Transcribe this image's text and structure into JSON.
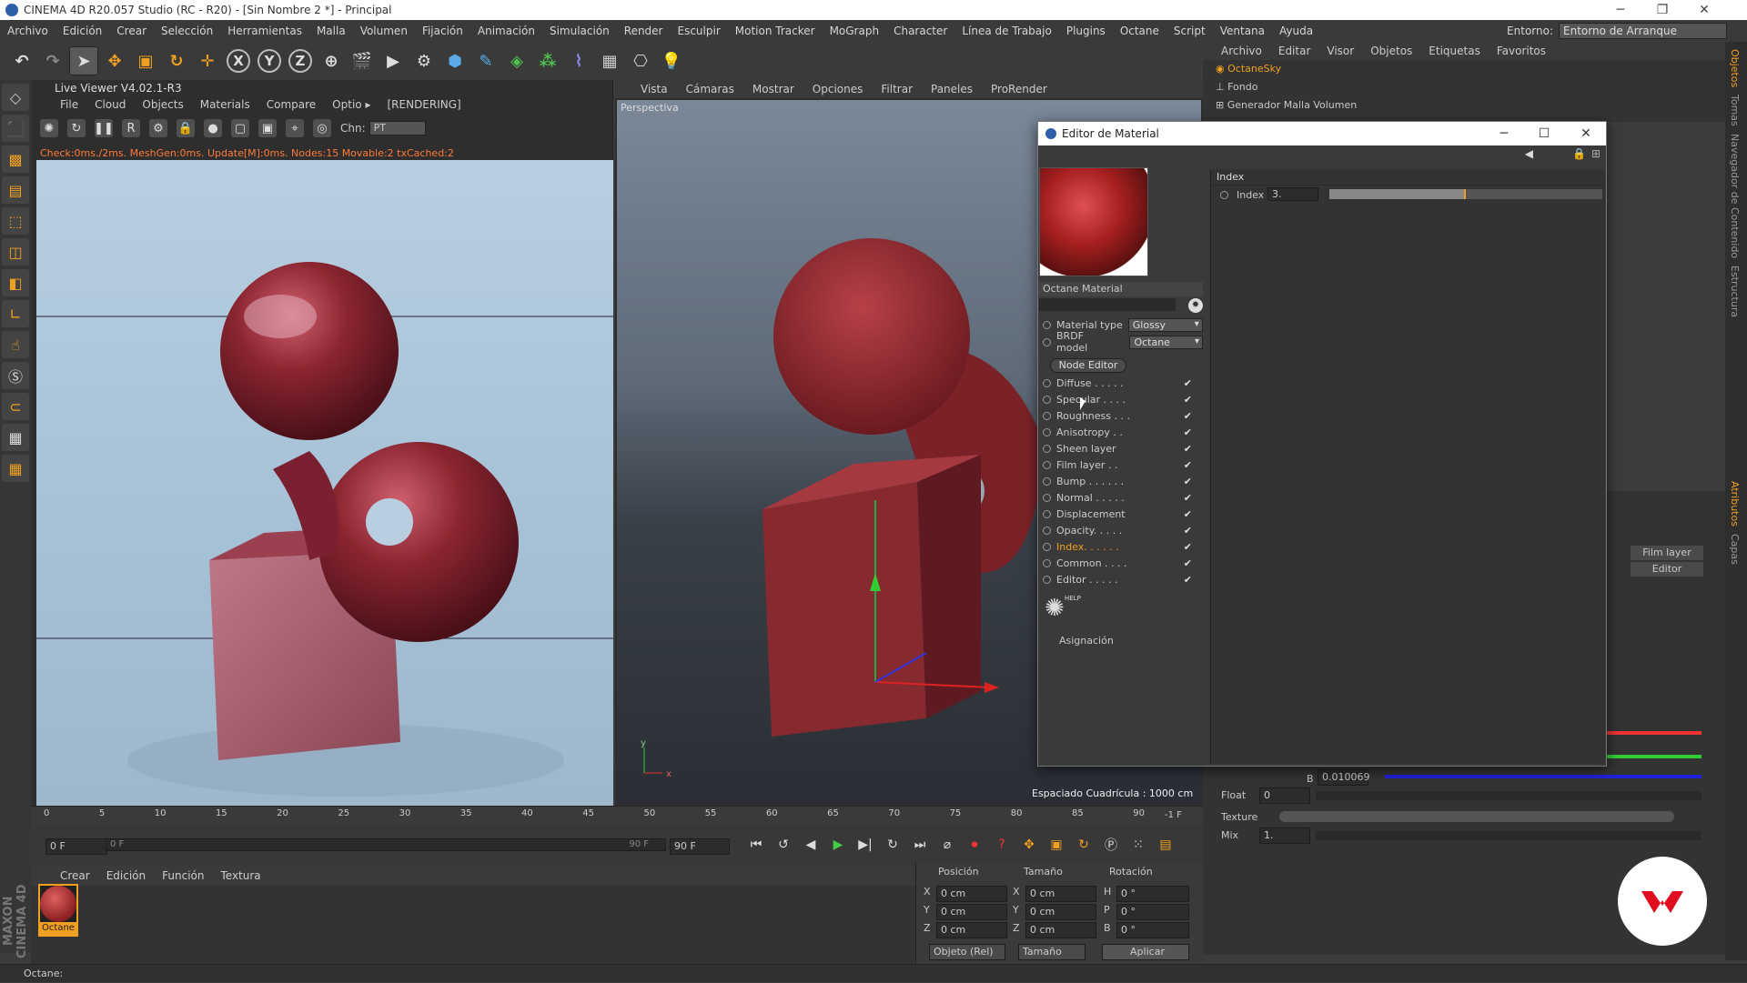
{
  "window": {
    "title": "CINEMA 4D R20.057 Studio (RC - R20) - [Sin Nombre 2 *] - Principal"
  },
  "menubar": {
    "items": [
      "Archivo",
      "Edición",
      "Crear",
      "Selección",
      "Herramientas",
      "Malla",
      "Volumen",
      "Fijación",
      "Animación",
      "Simulación",
      "Render",
      "Esculpir",
      "Motion Tracker",
      "MoGraph",
      "Character",
      "Línea de Trabajo",
      "Plugins",
      "Octane",
      "Script",
      "Ventana",
      "Ayuda"
    ],
    "entorno_label": "Entorno:",
    "entorno_value": "Entorno de Arranque"
  },
  "toolbar": {
    "icons": [
      "undo-icon",
      "redo-icon",
      "select-icon",
      "move-icon",
      "scale-icon",
      "rotate-icon",
      "live-select-icon",
      "x-axis",
      "y-axis",
      "z-axis",
      "world-coord-icon",
      "render-view-icon",
      "render-picture-icon",
      "render-settings-icon",
      "cube-icon",
      "pen-icon",
      "subdivision-icon",
      "array-icon",
      "deformer-icon",
      "floor-icon",
      "camera-icon",
      "light-icon"
    ],
    "axis_x": "X",
    "axis_y": "Y",
    "axis_z": "Z"
  },
  "live_viewer": {
    "title": "Live Viewer V4.02.1-R3",
    "menu": [
      "File",
      "Cloud",
      "Objects",
      "Materials",
      "Compare",
      "Optio"
    ],
    "menu_more": "▸",
    "rendering": "[RENDERING]",
    "channel_label": "Chn:",
    "channel_value": "PT",
    "status": "Check:0ms./2ms. MeshGen:0ms. Update[M]:0ms. Nodes:15 Movable:2 txCached:2"
  },
  "viewport": {
    "menu": [
      "Vista",
      "Cámaras",
      "Mostrar",
      "Opciones",
      "Filtrar",
      "Paneles",
      "ProRender"
    ],
    "label": "Perspectiva",
    "grid_info": "Espaciado Cuadrícula : 1000 cm"
  },
  "timeline": {
    "ticks": [
      "0",
      "5",
      "10",
      "15",
      "20",
      "25",
      "30",
      "35",
      "40",
      "45",
      "50",
      "55",
      "60",
      "65",
      "70",
      "75",
      "80",
      "85",
      "90"
    ],
    "current_frame": "-1 F",
    "start": "0 F",
    "range_start": "0 F",
    "range_end": "90 F",
    "end": "90 F"
  },
  "material_manager": {
    "menu": [
      "Crear",
      "Edición",
      "Función",
      "Textura"
    ],
    "material_name": "Octane"
  },
  "coordinates": {
    "headers": [
      "Posición",
      "Tamaño",
      "Rotación"
    ],
    "rows": [
      {
        "axis": "X",
        "pos": "0 cm",
        "size_axis": "X",
        "size": "0 cm",
        "rot_axis": "H",
        "rot": "0 °"
      },
      {
        "axis": "Y",
        "pos": "0 cm",
        "size_axis": "Y",
        "size": "0 cm",
        "rot_axis": "P",
        "rot": "0 °"
      },
      {
        "axis": "Z",
        "pos": "0 cm",
        "size_axis": "Z",
        "size": "0 cm",
        "rot_axis": "B",
        "rot": "0 °"
      }
    ],
    "mode": "Objeto (Rel)",
    "size_mode": "Tamaño",
    "apply": "Aplicar"
  },
  "object_manager": {
    "menu": [
      "Archivo",
      "Editar",
      "Visor",
      "Objetos",
      "Etiquetas",
      "Favoritos"
    ],
    "objects": [
      "OctaneSky",
      "Fondo",
      "Generador Malla Volumen"
    ]
  },
  "attributes": {
    "tabs": [
      "Film layer",
      "Editor"
    ],
    "b_value": "0.010069",
    "b_label": "B",
    "float_label": "Float",
    "float_value": "0",
    "texture_label": "Texture",
    "mix_label": "Mix",
    "mix_value": "1."
  },
  "right_tabs": [
    "Objetos",
    "Tomas",
    "Navegador de Contenido",
    "Estructura",
    "Atributos",
    "Capas"
  ],
  "material_editor": {
    "title": "Editor de Material",
    "material_name": "Octane Material",
    "material_type_label": "Material type",
    "material_type": "Glossy",
    "brdf_label": "BRDF model",
    "brdf": "Octane",
    "node_editor": "Node Editor",
    "channels": [
      {
        "label": "Diffuse . . . . .",
        "checked": true
      },
      {
        "label": "Specular . . . .",
        "checked": true
      },
      {
        "label": "Roughness . . .",
        "checked": true
      },
      {
        "label": "Anisotropy . .",
        "checked": true
      },
      {
        "label": "Sheen layer",
        "checked": true
      },
      {
        "label": "Film layer . .",
        "checked": true
      },
      {
        "label": "Bump . . . . . .",
        "checked": true
      },
      {
        "label": "Normal . . . . .",
        "checked": true
      },
      {
        "label": "Displacement",
        "checked": true
      },
      {
        "label": "Opacity. . . . .",
        "checked": true
      },
      {
        "label": "Index. . . . . .",
        "checked": true,
        "active": true
      },
      {
        "label": "Common . . . .",
        "checked": true
      },
      {
        "label": "Editor . . . . .",
        "checked": true
      }
    ],
    "help_label": "HELP",
    "assign": "Asignación",
    "section": "Index",
    "index_label": "Index",
    "index_value": "3.",
    "index_fraction": 0.5
  },
  "status": {
    "text": "Octane:"
  },
  "colors": {
    "accent": "#f0a020",
    "active_text": "#f0a020",
    "status_text": "#ff7a3a",
    "badge": "#e01020"
  }
}
